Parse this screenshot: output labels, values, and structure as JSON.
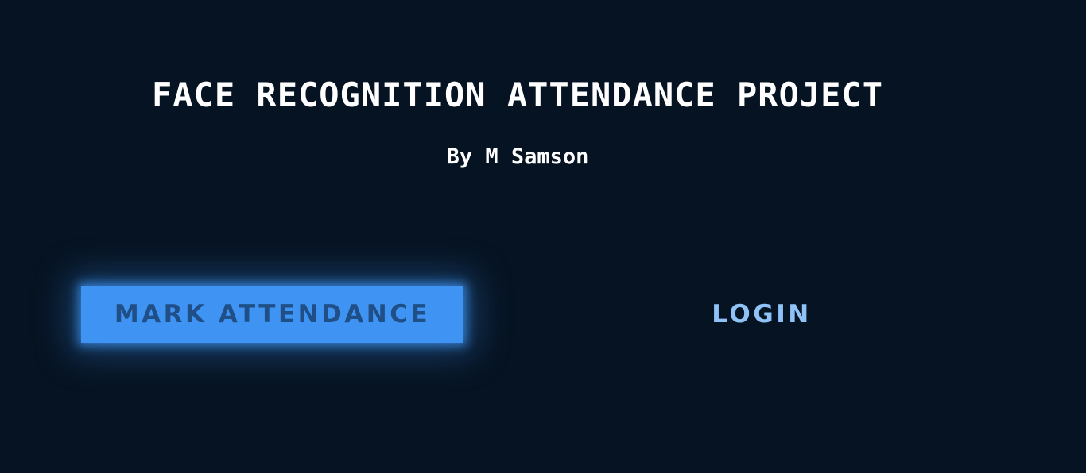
{
  "header": {
    "title": "FACE RECOGNITION ATTENDANCE PROJECT",
    "subtitle": "By M Samson"
  },
  "actions": {
    "mark_attendance_label": "MARK ATTENDANCE",
    "login_label": "LOGIN"
  },
  "colors": {
    "background": "#061322",
    "accent": "#3f94f3",
    "accent_text": "#1f4f86",
    "login_text": "#8fc2f7",
    "title_text": "#ffffff"
  }
}
